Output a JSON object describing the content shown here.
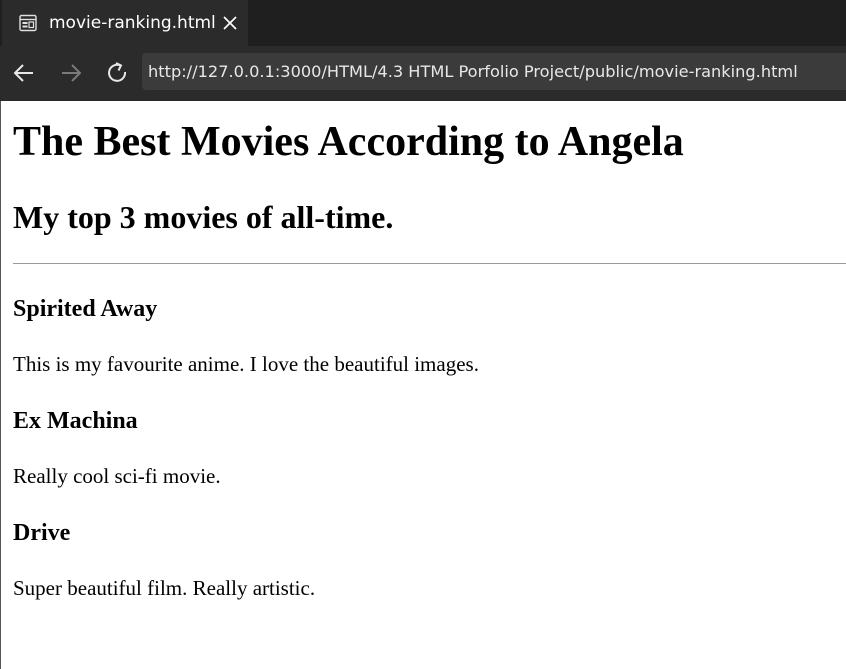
{
  "tab": {
    "title": "movie-ranking.html",
    "icon": "page-icon",
    "close_icon": "close-icon"
  },
  "toolbar": {
    "back_icon": "back-arrow-icon",
    "forward_icon": "forward-arrow-icon",
    "reload_icon": "reload-icon",
    "url": "http://127.0.0.1:3000/HTML/4.3 HTML Porfolio Project/public/movie-ranking.html"
  },
  "page": {
    "title": "The Best Movies According to Angela",
    "subtitle": "My top 3 movies of all-time.",
    "movies": [
      {
        "name": "Spirited Away",
        "description": "This is my favourite anime. I love the beautiful images."
      },
      {
        "name": "Ex Machina",
        "description": "Really cool sci-fi movie."
      },
      {
        "name": "Drive",
        "description": "Super beautiful film. Really artistic."
      }
    ]
  },
  "colors": {
    "tabbar_bg": "#1f1f1f",
    "toolbar_bg": "#2b2b2b",
    "address_bg": "#3b3b3b",
    "page_bg": "#ffffff"
  }
}
